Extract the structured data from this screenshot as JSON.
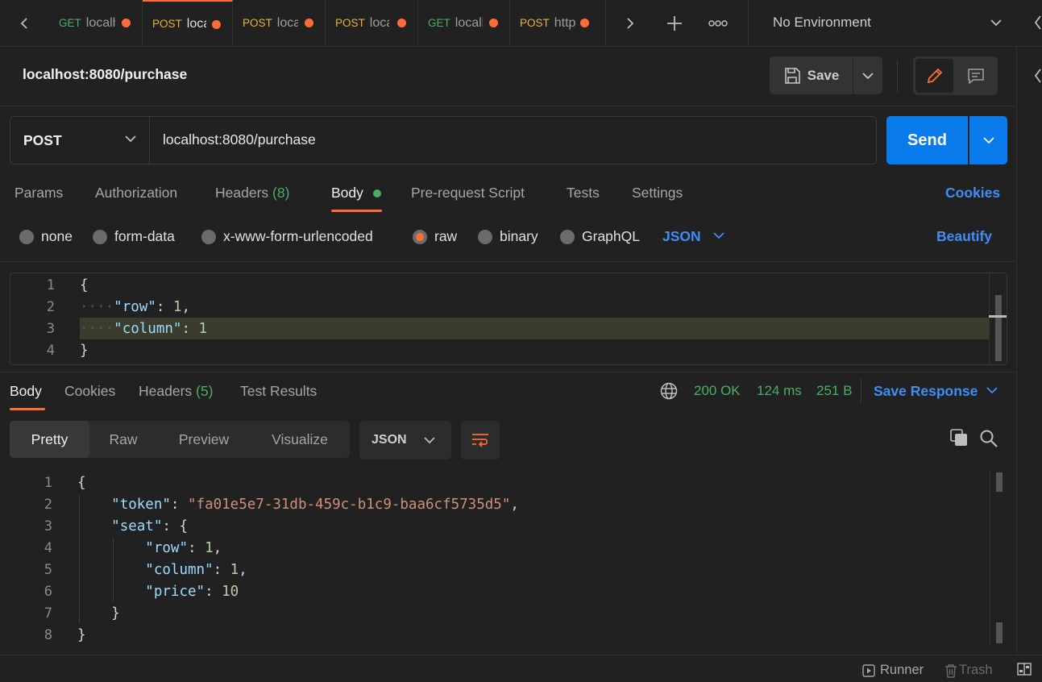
{
  "tabs": [
    {
      "method": "GET",
      "name": "localhost"
    },
    {
      "method": "POST",
      "name": "localhost"
    },
    {
      "method": "POST",
      "name": "localhost"
    },
    {
      "method": "POST",
      "name": "localhost"
    },
    {
      "method": "GET",
      "name": "localhost"
    },
    {
      "method": "POST",
      "name": "http"
    }
  ],
  "environment": "No Environment",
  "request": {
    "name": "localhost:8080/purchase",
    "save_label": "Save",
    "method": "POST",
    "url": "localhost:8080/purchase",
    "send_label": "Send"
  },
  "request_tabs": {
    "params": "Params",
    "authorization": "Authorization",
    "headers": "Headers",
    "headers_count": "(8)",
    "body": "Body",
    "prerequest": "Pre-request Script",
    "tests": "Tests",
    "settings": "Settings",
    "cookies": "Cookies"
  },
  "body_types": {
    "none": "none",
    "form_data": "form-data",
    "urlencoded": "x-www-form-urlencoded",
    "raw": "raw",
    "binary": "binary",
    "graphql": "GraphQL",
    "format": "JSON",
    "beautify": "Beautify"
  },
  "request_body": {
    "line_numbers": [
      "1",
      "2",
      "3",
      "4"
    ],
    "open": "{",
    "row_key": "\"row\"",
    "row_val": "1",
    "col_key": "\"column\"",
    "col_val": "1",
    "close": "}"
  },
  "response_tabs": {
    "body": "Body",
    "cookies": "Cookies",
    "headers": "Headers",
    "headers_count": "(5)",
    "test_results": "Test Results"
  },
  "response_status": {
    "status": "200 OK",
    "time": "124 ms",
    "size": "251 B",
    "save_response": "Save Response"
  },
  "view_modes": {
    "pretty": "Pretty",
    "raw": "Raw",
    "preview": "Preview",
    "visualize": "Visualize",
    "format": "JSON"
  },
  "response_body": {
    "line_numbers": [
      "1",
      "2",
      "3",
      "4",
      "5",
      "6",
      "7",
      "8"
    ],
    "token_key": "\"token\"",
    "token_val": "\"fa01e5e7-31db-459c-b1c9-baa6cf5735d5\"",
    "seat_key": "\"seat\"",
    "row_key": "\"row\"",
    "row_val": "1",
    "column_key": "\"column\"",
    "column_val": "1",
    "price_key": "\"price\"",
    "price_val": "10"
  },
  "footer": {
    "runner": "Runner",
    "trash": "Trash"
  },
  "colors": {
    "accent": "#ff6c37",
    "primary_button": "#097bed",
    "link": "#3f8ef5",
    "get_method": "#4cae62",
    "post_method": "#e8b339",
    "status_ok": "#4cae62"
  }
}
